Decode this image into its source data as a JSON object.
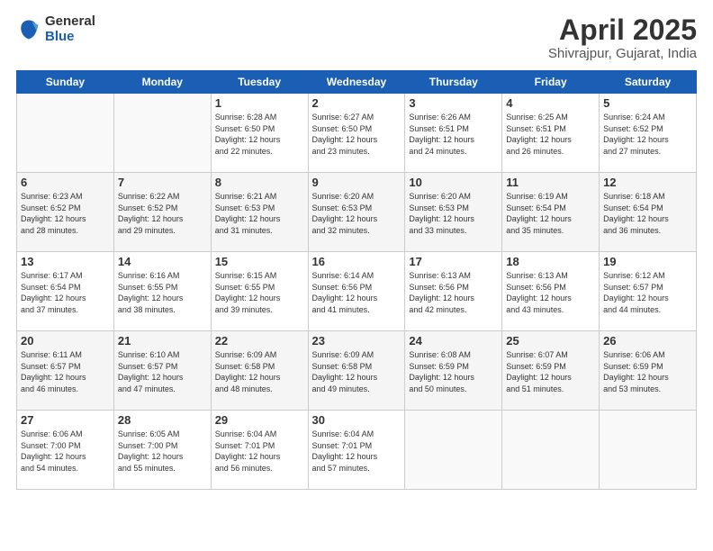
{
  "logo": {
    "general": "General",
    "blue": "Blue"
  },
  "title": "April 2025",
  "subtitle": "Shivrajpur, Gujarat, India",
  "days_of_week": [
    "Sunday",
    "Monday",
    "Tuesday",
    "Wednesday",
    "Thursday",
    "Friday",
    "Saturday"
  ],
  "weeks": [
    [
      {
        "day": "",
        "info": ""
      },
      {
        "day": "",
        "info": ""
      },
      {
        "day": "1",
        "info": "Sunrise: 6:28 AM\nSunset: 6:50 PM\nDaylight: 12 hours\nand 22 minutes."
      },
      {
        "day": "2",
        "info": "Sunrise: 6:27 AM\nSunset: 6:50 PM\nDaylight: 12 hours\nand 23 minutes."
      },
      {
        "day": "3",
        "info": "Sunrise: 6:26 AM\nSunset: 6:51 PM\nDaylight: 12 hours\nand 24 minutes."
      },
      {
        "day": "4",
        "info": "Sunrise: 6:25 AM\nSunset: 6:51 PM\nDaylight: 12 hours\nand 26 minutes."
      },
      {
        "day": "5",
        "info": "Sunrise: 6:24 AM\nSunset: 6:52 PM\nDaylight: 12 hours\nand 27 minutes."
      }
    ],
    [
      {
        "day": "6",
        "info": "Sunrise: 6:23 AM\nSunset: 6:52 PM\nDaylight: 12 hours\nand 28 minutes."
      },
      {
        "day": "7",
        "info": "Sunrise: 6:22 AM\nSunset: 6:52 PM\nDaylight: 12 hours\nand 29 minutes."
      },
      {
        "day": "8",
        "info": "Sunrise: 6:21 AM\nSunset: 6:53 PM\nDaylight: 12 hours\nand 31 minutes."
      },
      {
        "day": "9",
        "info": "Sunrise: 6:20 AM\nSunset: 6:53 PM\nDaylight: 12 hours\nand 32 minutes."
      },
      {
        "day": "10",
        "info": "Sunrise: 6:20 AM\nSunset: 6:53 PM\nDaylight: 12 hours\nand 33 minutes."
      },
      {
        "day": "11",
        "info": "Sunrise: 6:19 AM\nSunset: 6:54 PM\nDaylight: 12 hours\nand 35 minutes."
      },
      {
        "day": "12",
        "info": "Sunrise: 6:18 AM\nSunset: 6:54 PM\nDaylight: 12 hours\nand 36 minutes."
      }
    ],
    [
      {
        "day": "13",
        "info": "Sunrise: 6:17 AM\nSunset: 6:54 PM\nDaylight: 12 hours\nand 37 minutes."
      },
      {
        "day": "14",
        "info": "Sunrise: 6:16 AM\nSunset: 6:55 PM\nDaylight: 12 hours\nand 38 minutes."
      },
      {
        "day": "15",
        "info": "Sunrise: 6:15 AM\nSunset: 6:55 PM\nDaylight: 12 hours\nand 39 minutes."
      },
      {
        "day": "16",
        "info": "Sunrise: 6:14 AM\nSunset: 6:56 PM\nDaylight: 12 hours\nand 41 minutes."
      },
      {
        "day": "17",
        "info": "Sunrise: 6:13 AM\nSunset: 6:56 PM\nDaylight: 12 hours\nand 42 minutes."
      },
      {
        "day": "18",
        "info": "Sunrise: 6:13 AM\nSunset: 6:56 PM\nDaylight: 12 hours\nand 43 minutes."
      },
      {
        "day": "19",
        "info": "Sunrise: 6:12 AM\nSunset: 6:57 PM\nDaylight: 12 hours\nand 44 minutes."
      }
    ],
    [
      {
        "day": "20",
        "info": "Sunrise: 6:11 AM\nSunset: 6:57 PM\nDaylight: 12 hours\nand 46 minutes."
      },
      {
        "day": "21",
        "info": "Sunrise: 6:10 AM\nSunset: 6:57 PM\nDaylight: 12 hours\nand 47 minutes."
      },
      {
        "day": "22",
        "info": "Sunrise: 6:09 AM\nSunset: 6:58 PM\nDaylight: 12 hours\nand 48 minutes."
      },
      {
        "day": "23",
        "info": "Sunrise: 6:09 AM\nSunset: 6:58 PM\nDaylight: 12 hours\nand 49 minutes."
      },
      {
        "day": "24",
        "info": "Sunrise: 6:08 AM\nSunset: 6:59 PM\nDaylight: 12 hours\nand 50 minutes."
      },
      {
        "day": "25",
        "info": "Sunrise: 6:07 AM\nSunset: 6:59 PM\nDaylight: 12 hours\nand 51 minutes."
      },
      {
        "day": "26",
        "info": "Sunrise: 6:06 AM\nSunset: 6:59 PM\nDaylight: 12 hours\nand 53 minutes."
      }
    ],
    [
      {
        "day": "27",
        "info": "Sunrise: 6:06 AM\nSunset: 7:00 PM\nDaylight: 12 hours\nand 54 minutes."
      },
      {
        "day": "28",
        "info": "Sunrise: 6:05 AM\nSunset: 7:00 PM\nDaylight: 12 hours\nand 55 minutes."
      },
      {
        "day": "29",
        "info": "Sunrise: 6:04 AM\nSunset: 7:01 PM\nDaylight: 12 hours\nand 56 minutes."
      },
      {
        "day": "30",
        "info": "Sunrise: 6:04 AM\nSunset: 7:01 PM\nDaylight: 12 hours\nand 57 minutes."
      },
      {
        "day": "",
        "info": ""
      },
      {
        "day": "",
        "info": ""
      },
      {
        "day": "",
        "info": ""
      }
    ]
  ]
}
